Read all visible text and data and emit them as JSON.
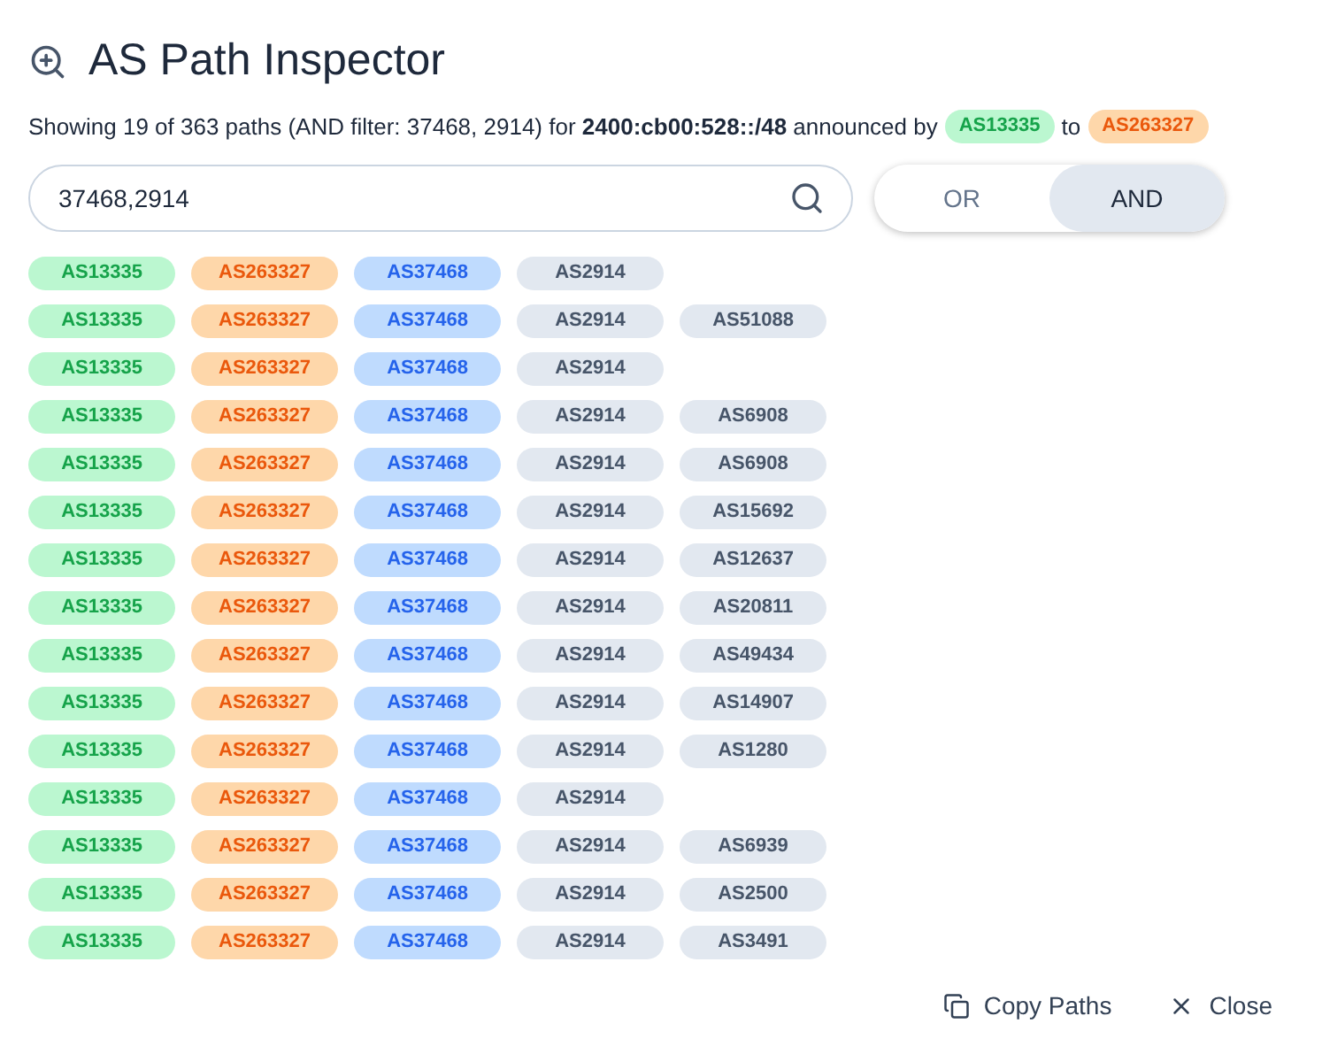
{
  "title": "AS Path Inspector",
  "summary": {
    "text": "Showing 19 of 363 paths (AND filter: 37468, 2914) for **2400:cb00:528::/48** announced by",
    "source": {
      "label": "AS13335",
      "kind": "source"
    },
    "joiner": "to",
    "target": {
      "label": "AS263327",
      "kind": "target"
    }
  },
  "search": {
    "value": "37468,2914"
  },
  "mode_toggle": [
    {
      "label": "OR",
      "selected": false
    },
    {
      "label": "AND",
      "selected": true
    }
  ],
  "paths": [
    [
      {
        "label": "AS13335",
        "kind": "source"
      },
      {
        "label": "AS263327",
        "kind": "target"
      },
      {
        "label": "AS37468",
        "kind": "match"
      },
      {
        "label": "AS2914",
        "kind": "hop"
      }
    ],
    [
      {
        "label": "AS13335",
        "kind": "source"
      },
      {
        "label": "AS263327",
        "kind": "target"
      },
      {
        "label": "AS37468",
        "kind": "match"
      },
      {
        "label": "AS2914",
        "kind": "hop"
      },
      {
        "label": "AS51088",
        "kind": "hop"
      }
    ],
    [
      {
        "label": "AS13335",
        "kind": "source"
      },
      {
        "label": "AS263327",
        "kind": "target"
      },
      {
        "label": "AS37468",
        "kind": "match"
      },
      {
        "label": "AS2914",
        "kind": "hop"
      }
    ],
    [
      {
        "label": "AS13335",
        "kind": "source"
      },
      {
        "label": "AS263327",
        "kind": "target"
      },
      {
        "label": "AS37468",
        "kind": "match"
      },
      {
        "label": "AS2914",
        "kind": "hop"
      },
      {
        "label": "AS6908",
        "kind": "hop"
      }
    ],
    [
      {
        "label": "AS13335",
        "kind": "source"
      },
      {
        "label": "AS263327",
        "kind": "target"
      },
      {
        "label": "AS37468",
        "kind": "match"
      },
      {
        "label": "AS2914",
        "kind": "hop"
      },
      {
        "label": "AS6908",
        "kind": "hop"
      }
    ],
    [
      {
        "label": "AS13335",
        "kind": "source"
      },
      {
        "label": "AS263327",
        "kind": "target"
      },
      {
        "label": "AS37468",
        "kind": "match"
      },
      {
        "label": "AS2914",
        "kind": "hop"
      },
      {
        "label": "AS15692",
        "kind": "hop"
      }
    ],
    [
      {
        "label": "AS13335",
        "kind": "source"
      },
      {
        "label": "AS263327",
        "kind": "target"
      },
      {
        "label": "AS37468",
        "kind": "match"
      },
      {
        "label": "AS2914",
        "kind": "hop"
      },
      {
        "label": "AS12637",
        "kind": "hop"
      }
    ],
    [
      {
        "label": "AS13335",
        "kind": "source"
      },
      {
        "label": "AS263327",
        "kind": "target"
      },
      {
        "label": "AS37468",
        "kind": "match"
      },
      {
        "label": "AS2914",
        "kind": "hop"
      },
      {
        "label": "AS20811",
        "kind": "hop"
      }
    ],
    [
      {
        "label": "AS13335",
        "kind": "source"
      },
      {
        "label": "AS263327",
        "kind": "target"
      },
      {
        "label": "AS37468",
        "kind": "match"
      },
      {
        "label": "AS2914",
        "kind": "hop"
      },
      {
        "label": "AS49434",
        "kind": "hop"
      }
    ],
    [
      {
        "label": "AS13335",
        "kind": "source"
      },
      {
        "label": "AS263327",
        "kind": "target"
      },
      {
        "label": "AS37468",
        "kind": "match"
      },
      {
        "label": "AS2914",
        "kind": "hop"
      },
      {
        "label": "AS14907",
        "kind": "hop"
      }
    ],
    [
      {
        "label": "AS13335",
        "kind": "source"
      },
      {
        "label": "AS263327",
        "kind": "target"
      },
      {
        "label": "AS37468",
        "kind": "match"
      },
      {
        "label": "AS2914",
        "kind": "hop"
      },
      {
        "label": "AS1280",
        "kind": "hop"
      }
    ],
    [
      {
        "label": "AS13335",
        "kind": "source"
      },
      {
        "label": "AS263327",
        "kind": "target"
      },
      {
        "label": "AS37468",
        "kind": "match"
      },
      {
        "label": "AS2914",
        "kind": "hop"
      }
    ],
    [
      {
        "label": "AS13335",
        "kind": "source"
      },
      {
        "label": "AS263327",
        "kind": "target"
      },
      {
        "label": "AS37468",
        "kind": "match"
      },
      {
        "label": "AS2914",
        "kind": "hop"
      },
      {
        "label": "AS6939",
        "kind": "hop"
      }
    ],
    [
      {
        "label": "AS13335",
        "kind": "source"
      },
      {
        "label": "AS263327",
        "kind": "target"
      },
      {
        "label": "AS37468",
        "kind": "match"
      },
      {
        "label": "AS2914",
        "kind": "hop"
      },
      {
        "label": "AS2500",
        "kind": "hop"
      }
    ],
    [
      {
        "label": "AS13335",
        "kind": "source"
      },
      {
        "label": "AS263327",
        "kind": "target"
      },
      {
        "label": "AS37468",
        "kind": "match"
      },
      {
        "label": "AS2914",
        "kind": "hop"
      },
      {
        "label": "AS3491",
        "kind": "hop"
      }
    ]
  ],
  "actions": [
    {
      "label": "Copy Paths",
      "kind": "copy"
    },
    {
      "label": "Close",
      "kind": "close"
    }
  ]
}
